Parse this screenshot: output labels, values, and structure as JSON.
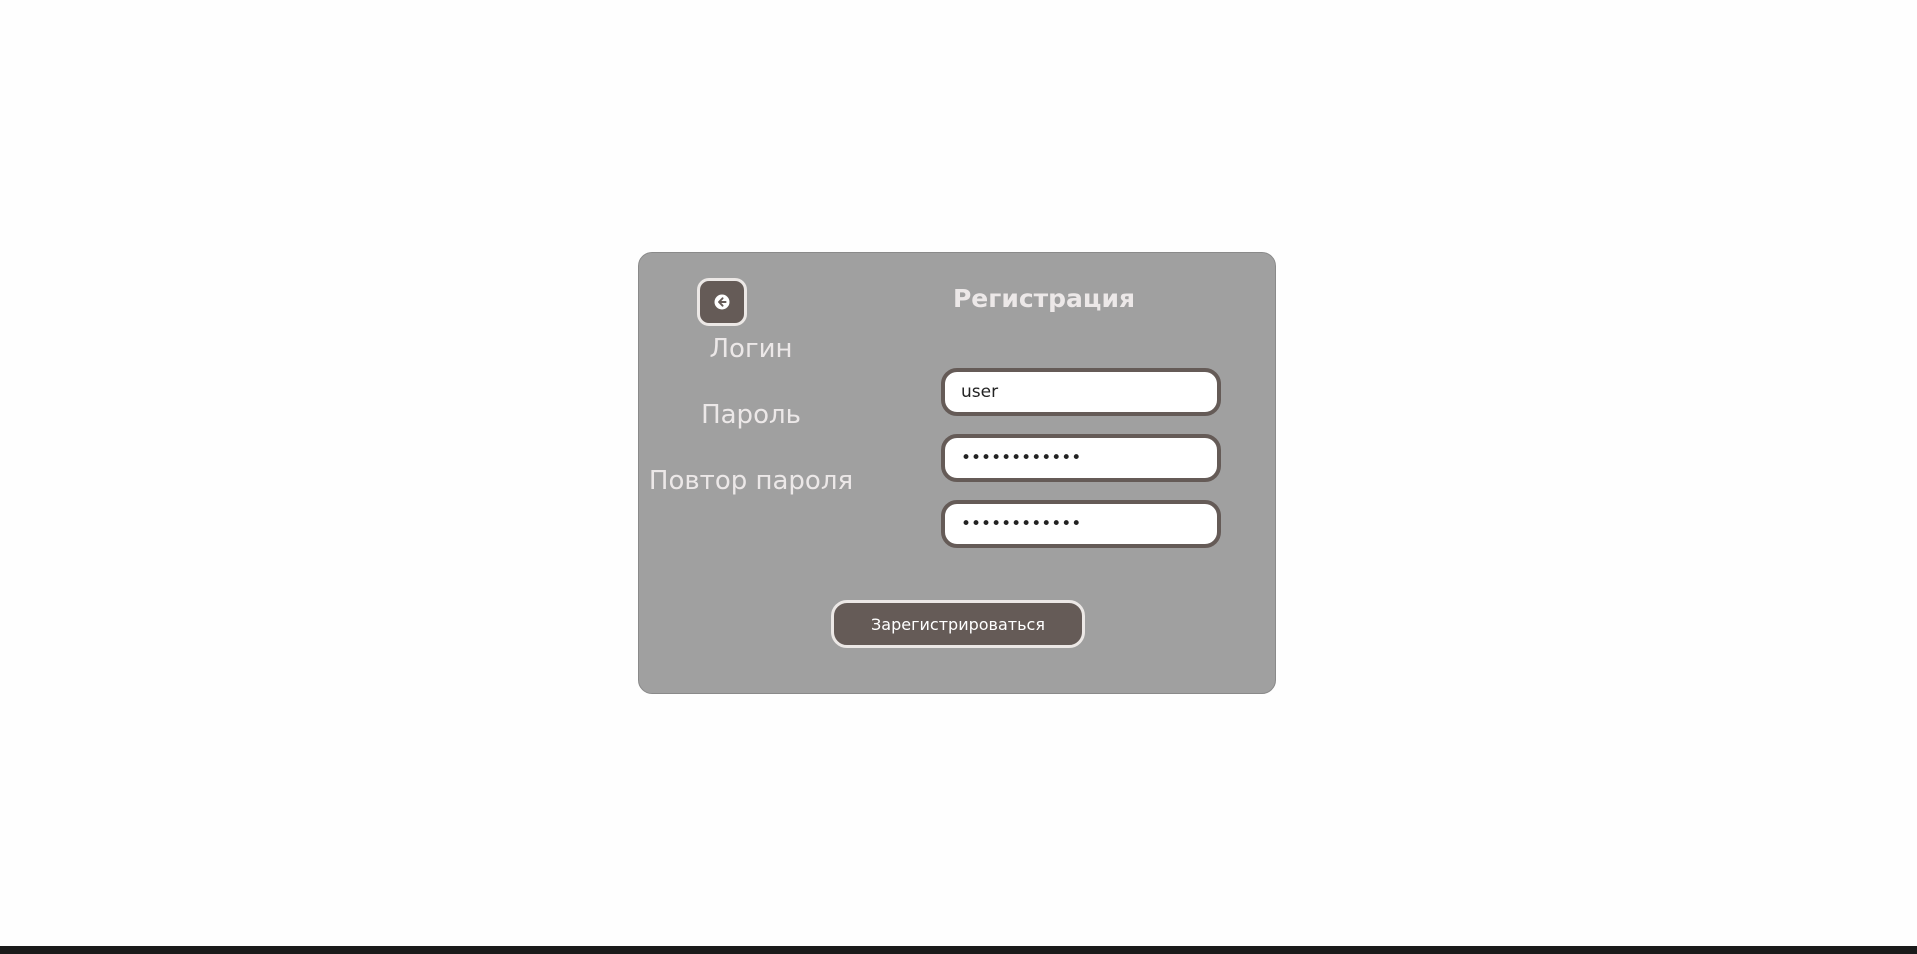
{
  "card": {
    "title": "Регистрация",
    "back_button": {
      "icon": "arrow-left-circle-icon"
    }
  },
  "form": {
    "login": {
      "label": "Логин",
      "value": "user"
    },
    "password": {
      "label": "Пароль",
      "value": "••••••••••••"
    },
    "password_repeat": {
      "label": "Повтор пароля",
      "value": "••••••••••••"
    },
    "submit_label": "Зарегистрироваться"
  },
  "colors": {
    "page_background": "#fefefe",
    "card_background": "#a0a0a0",
    "accent": "#655b57",
    "light_text": "#ece8e8"
  }
}
